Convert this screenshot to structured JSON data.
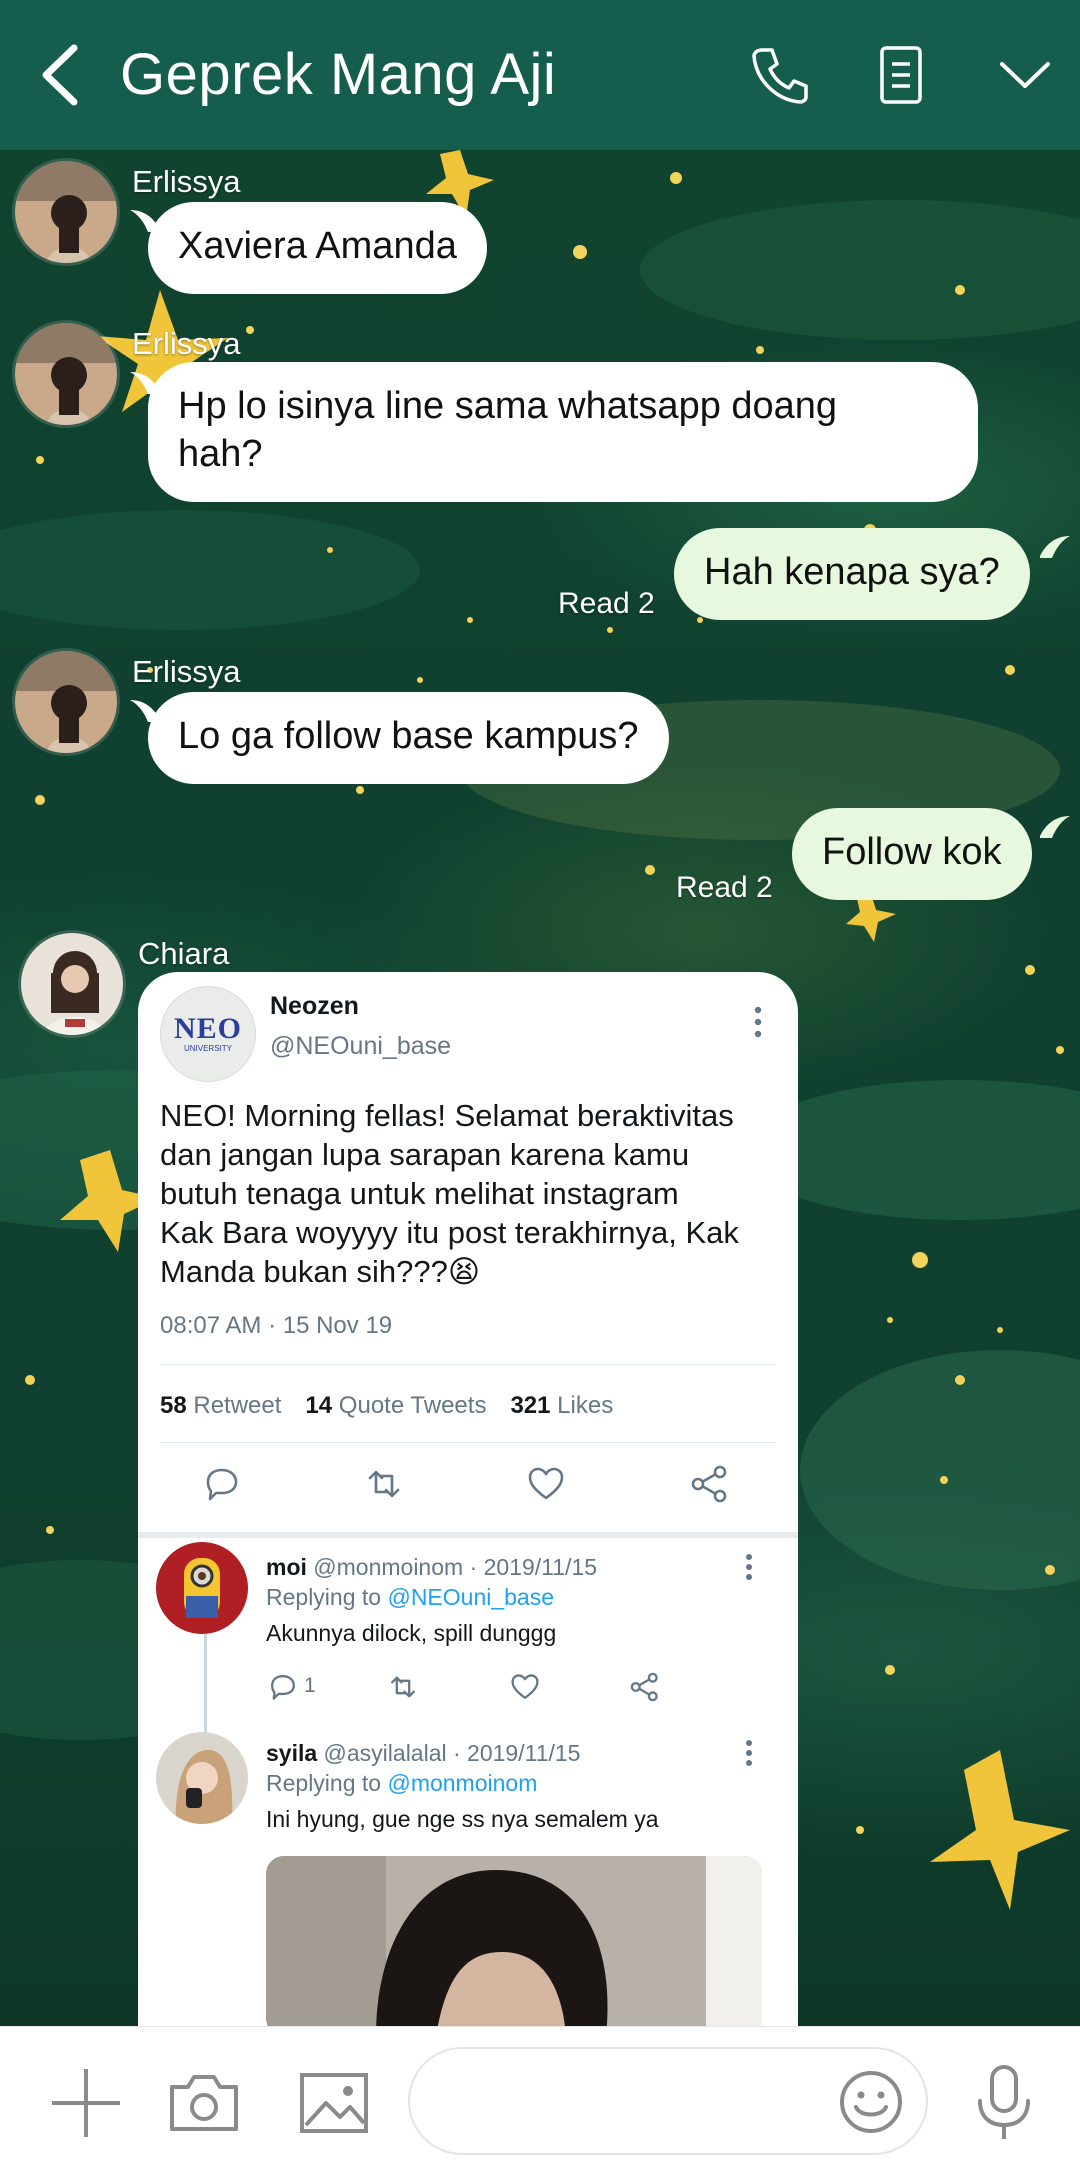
{
  "header": {
    "title": "Geprek Mang Aji",
    "background_color": "#155e4e",
    "icons": [
      "back-arrow-icon",
      "phone-icon",
      "notes-icon",
      "chevron-down-icon"
    ]
  },
  "messages": [
    {
      "sender": "Erlissya",
      "direction": "in",
      "text": "Xaviera Amanda"
    },
    {
      "sender": "Erlissya",
      "direction": "in",
      "text_lines": [
        "Hp lo isinya line sama whatsapp doang",
        "hah?"
      ]
    },
    {
      "direction": "out",
      "text": "Hah kenapa sya?",
      "read": "Read 2"
    },
    {
      "sender": "Erlissya",
      "direction": "in",
      "text": "Lo ga follow base kampus?"
    },
    {
      "direction": "out",
      "text": "Follow kok",
      "read": "Read 2"
    }
  ],
  "tweet_share": {
    "sender": "Chiara",
    "tweet": {
      "author_name": "Neozen",
      "author_handle": "@NEOuni_base",
      "logo_text": "NEO",
      "logo_subtext": "UNIVERSITY",
      "text_lines": [
        "NEO! Morning fellas! Selamat beraktivitas",
        "dan jangan lupa sarapan karena kamu",
        "butuh tenaga untuk melihat instagram",
        "Kak Bara woyyyy itu post terakhirnya, Kak",
        "Manda bukan sih???😫"
      ],
      "timestamp": "08:07 AM · 15 Nov 19",
      "retweets_count": "58",
      "retweets_label": "Retweet",
      "quotes_count": "14",
      "quotes_label": "Quote Tweets",
      "likes_count": "321",
      "likes_label": "Likes"
    },
    "replies": [
      {
        "name": "moi",
        "meta": "@monmoinom · 2019/11/15",
        "replying_prefix": "Replying to",
        "replying_to": "@NEOuni_base",
        "text": "Akunnya dilock, spill dunggg",
        "reply_count": "1"
      },
      {
        "name": "syila",
        "meta": "@asyilalalal · 2019/11/15",
        "replying_prefix": "Replying to",
        "replying_to": "@monmoinom",
        "text": "Ini hyung, gue nge ss nya semalem ya"
      }
    ]
  },
  "input_bar": {
    "placeholder": "",
    "icons": [
      "plus-icon",
      "camera-icon",
      "image-icon",
      "emoji-icon",
      "microphone-icon"
    ]
  },
  "colors": {
    "incoming_bubble": "#ffffff",
    "outgoing_bubble": "#e8f8df",
    "link_blue": "#1da1f2"
  }
}
